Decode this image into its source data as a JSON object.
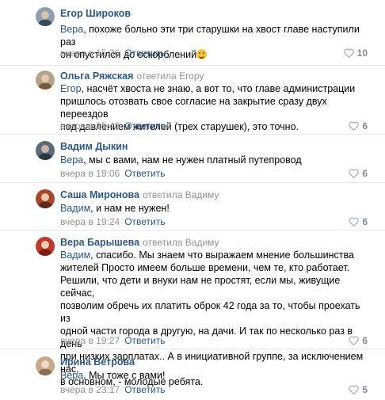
{
  "comments": [
    {
      "author": "Егор Широков",
      "reply_to": "",
      "mention": "Вера",
      "lines": [
        ", похоже больно эти три старушки на хвост главе наступили раз",
        "он опустился до оскорблений"
      ],
      "emoji": "rofl-emoji",
      "time": "вчера в 15:36",
      "reply_label": "Ответить",
      "likes": "10"
    },
    {
      "author": "Ольга Ряжская",
      "reply_to": "ответила Егору",
      "mention": "Егор",
      "lines": [
        ", насчёт хвоста не знаю, а вот то, что главе администрации",
        "пришлось отозвать свое согласие на закрытие сразу двух переездов",
        "под давлением жителей (трех старушек), это точно."
      ],
      "time": "вчера в 15:48",
      "reply_label": "Ответить",
      "likes": "6"
    },
    {
      "author": "Вадим Дыкин",
      "reply_to": "",
      "mention": "Вера",
      "lines": [
        ", мы с вами, нам не нужен платный путепровод"
      ],
      "time": "вчера в 19:06",
      "reply_label": "Ответить",
      "likes": "6"
    },
    {
      "author": "Саша Миронова",
      "reply_to": "ответила Вадиму",
      "mention": "Вадим",
      "lines": [
        ", и нам не нужен!"
      ],
      "time": "вчера в 19:24",
      "reply_label": "Ответить",
      "likes": "6"
    },
    {
      "author": "Вера Барышева",
      "reply_to": "ответила Вадиму",
      "mention": "Вадим",
      "lines": [
        ", спасибо. Мы знаем что выражаем мнение большинства",
        "жителей Просто имеем больше времени, чем те, кто работает.",
        "Решили, что дети и внуки нам не простят, если мы, живущие сейчас,",
        "позволим обречь их платить оброк 42 года за то, чтобы проехать из",
        "одной части города в другую, на дачи. И так по несколько раз в день",
        "при низких зарплатах.. А в инициативной группе, за исключением нас,",
        "в основном, - молодые ребята."
      ],
      "time": "вчера в 19:27",
      "reply_label": "Ответить",
      "likes": "6"
    },
    {
      "author": "Ирина Ветрова",
      "reply_to": "",
      "mention": "Вера",
      "lines": [
        ", Мы тоже с вами!"
      ],
      "time": "вчера в 23:17",
      "reply_label": "Ответить",
      "likes": "5"
    }
  ],
  "icons": {
    "like": "heart-icon"
  },
  "colors": {
    "link": "#2a5885",
    "meta": "#939393",
    "divider": "#e7e8ec",
    "like": "#828a99"
  }
}
